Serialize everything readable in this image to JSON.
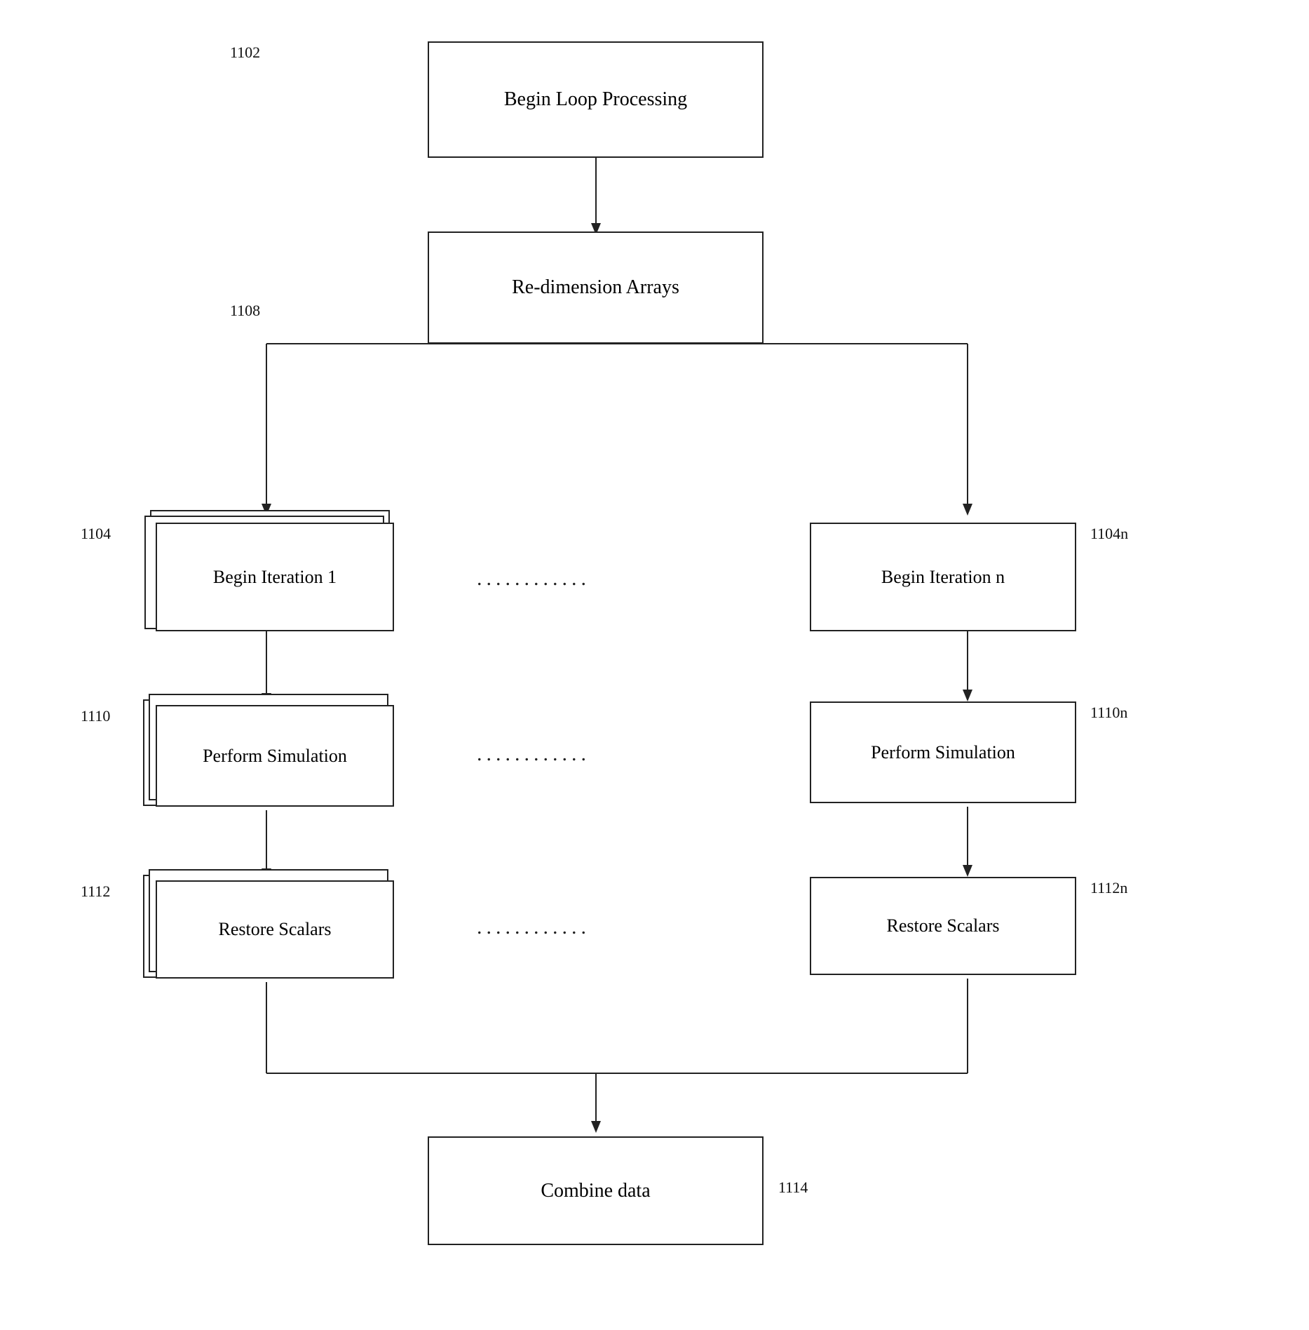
{
  "diagram": {
    "title": "Flowchart",
    "nodes": {
      "begin_loop": {
        "label": "Begin Loop Processing",
        "ref": "1102"
      },
      "redimension": {
        "label": "Re-dimension Arrays",
        "ref": "1108"
      },
      "begin_iter_1": {
        "label": "Begin Iteration 1",
        "ref": "1104"
      },
      "begin_iter_n": {
        "label": "Begin Iteration n",
        "ref": "1104n"
      },
      "perform_sim_1": {
        "label": "Perform Simulation",
        "ref": "1110"
      },
      "perform_sim_n": {
        "label": "Perform Simulation",
        "ref": "1110n"
      },
      "restore_scalars_1": {
        "label": "Restore Scalars",
        "ref": "1112"
      },
      "restore_scalars_n": {
        "label": "Restore Scalars",
        "ref": "1112n"
      },
      "combine_data": {
        "label": "Combine data",
        "ref": "1114"
      }
    },
    "dots": "............"
  }
}
